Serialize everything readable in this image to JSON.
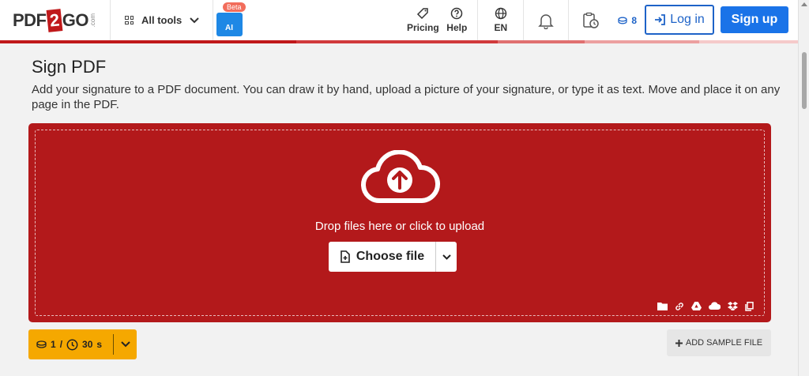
{
  "header": {
    "logo": {
      "part1": "PDF",
      "part2": "2",
      "part3": "GO",
      "part4": ".com"
    },
    "all_tools": "All tools",
    "ai_badge": "Beta",
    "ai_label": "AI",
    "pricing": "Pricing",
    "help": "Help",
    "language": "EN",
    "credits": "8",
    "login": "Log in",
    "signup": "Sign up"
  },
  "colors": {
    "brand_red": "#b3191b",
    "accent_blue": "#1a73e8",
    "credit_yellow": "#f5a800"
  },
  "main": {
    "title": "Sign PDF",
    "description": "Add your signature to a PDF document. You can draw it by hand, upload a picture of your signature, or type it as text. Move and place it on any page in the PDF.",
    "drop_text": "Drop files here or click to upload",
    "choose_file": "Choose file",
    "sources": [
      "folder-icon",
      "link-icon",
      "google-drive-icon",
      "onedrive-icon",
      "dropbox-icon",
      "clipboard-icon"
    ]
  },
  "footer_controls": {
    "credit_cost": "1",
    "separator": "/",
    "time": "30",
    "time_unit": "s",
    "add_sample": "ADD SAMPLE FILE"
  }
}
